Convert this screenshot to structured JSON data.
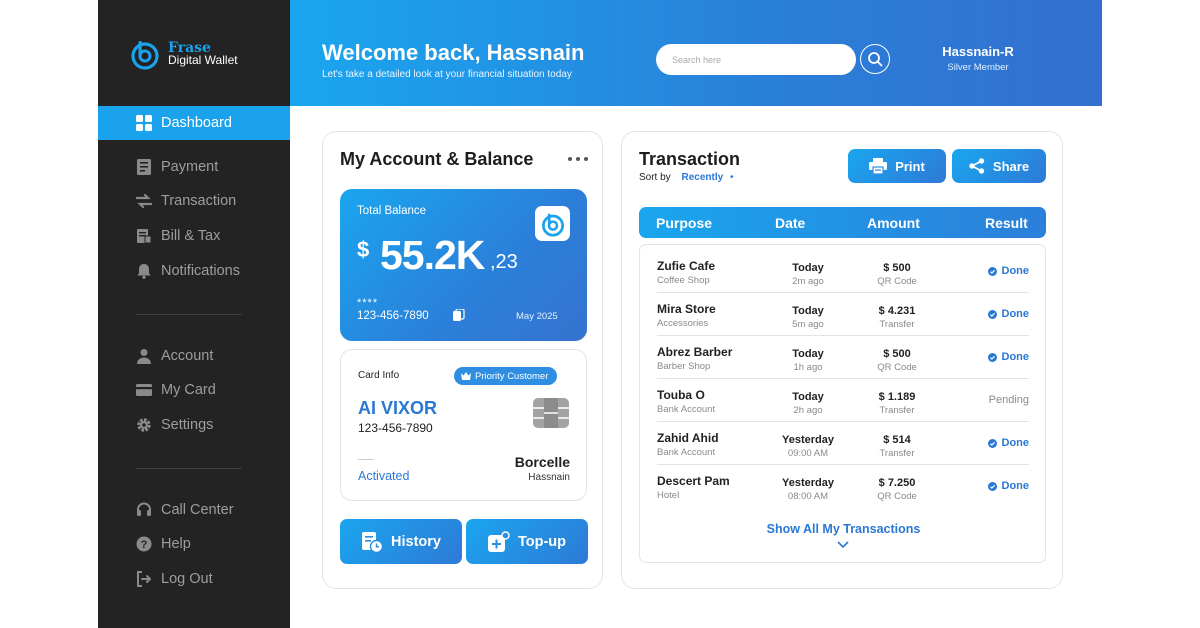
{
  "app": {
    "brand": "Frase",
    "subtitle": "Digital Wallet",
    "accent": "#1aa3ec",
    "sidebar_bg": "#232323"
  },
  "sidebar": {
    "items": [
      {
        "label": "Dashboard",
        "icon": "dashboard-icon",
        "active": true
      },
      {
        "label": "Payment",
        "icon": "payment-icon"
      },
      {
        "label": "Transaction",
        "icon": "transfer-icon"
      },
      {
        "label": "Bill & Tax",
        "icon": "bill-icon"
      },
      {
        "label": "Notifications",
        "icon": "bell-icon"
      },
      {
        "label": "Account",
        "icon": "user-icon"
      },
      {
        "label": "My Card",
        "icon": "card-icon"
      },
      {
        "label": "Settings",
        "icon": "gear-icon"
      },
      {
        "label": "Call Center",
        "icon": "headset-icon"
      },
      {
        "label": "Help",
        "icon": "help-icon"
      },
      {
        "label": "Log Out",
        "icon": "logout-icon"
      }
    ]
  },
  "header": {
    "welcome": "Welcome back, Hassnain",
    "subtitle": "Let's take a detailed look at your financial situation today",
    "search_placeholder": "Search here",
    "user_name": "Hassnain-R",
    "user_level": "Silver Member"
  },
  "account": {
    "title": "My Account & Balance",
    "balance": {
      "label": "Total Balance",
      "currency": "$",
      "amount": "55.2K",
      "cents": ",23",
      "masked": "****",
      "number": "123-456-7890",
      "date": "May 2025"
    },
    "card": {
      "label": "Card Info",
      "badge": "Priority Customer",
      "holder": "AI VIXOR",
      "number": "123-456-7890",
      "status": "Activated",
      "bank": "Borcelle",
      "bank_sub": "Hassnain"
    },
    "actions": {
      "history": "History",
      "topup": "Top-up"
    }
  },
  "transactions": {
    "title": "Transaction",
    "sort_label": "Sort by",
    "sort_value": "Recently",
    "print": "Print",
    "share": "Share",
    "columns": [
      "Purpose",
      "Date",
      "Amount",
      "Result"
    ],
    "rows": [
      {
        "name": "Zufie Cafe",
        "category": "Coffee Shop",
        "date": "Today",
        "time": "2m ago",
        "amount": "$ 500",
        "method": "QR Code",
        "result": "Done"
      },
      {
        "name": "Mira Store",
        "category": "Accessories",
        "date": "Today",
        "time": "5m ago",
        "amount": "$ 4.231",
        "method": "Transfer",
        "result": "Done"
      },
      {
        "name": "Abrez Barber",
        "category": "Barber Shop",
        "date": "Today",
        "time": "1h ago",
        "amount": "$ 500",
        "method": "QR Code",
        "result": "Done"
      },
      {
        "name": "Touba O",
        "category": "Bank Account",
        "date": "Today",
        "time": "2h ago",
        "amount": "$ 1.189",
        "method": "Transfer",
        "result": "Pending"
      },
      {
        "name": "Zahid Ahid",
        "category": "Bank Account",
        "date": "Yesterday",
        "time": "09:00 AM",
        "amount": "$ 514",
        "method": "Transfer",
        "result": "Done"
      },
      {
        "name": "Descert Pam",
        "category": "Hotel",
        "date": "Yesterday",
        "time": "08:00 AM",
        "amount": "$ 7.250",
        "method": "QR Code",
        "result": "Done"
      }
    ],
    "show_all": "Show All My Transactions"
  }
}
